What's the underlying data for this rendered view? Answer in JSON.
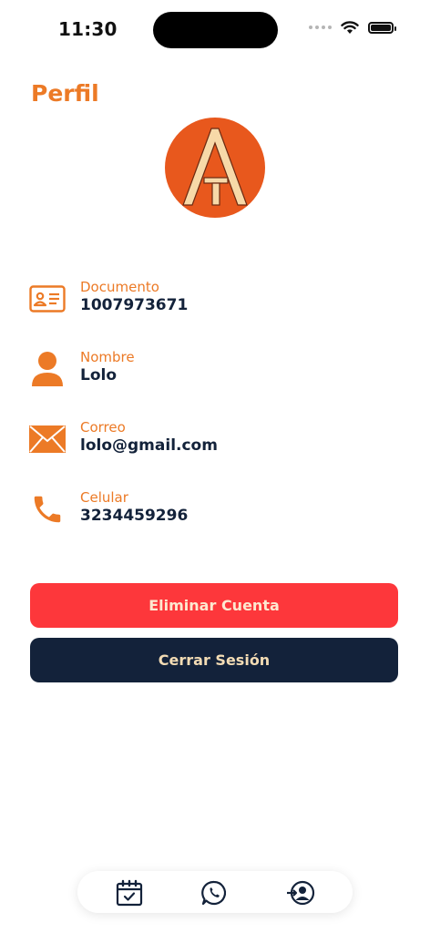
{
  "status_bar": {
    "time": "11:30"
  },
  "header": {
    "title": "Perfil"
  },
  "colors": {
    "accent": "#ec7a26",
    "navy": "#13223a",
    "danger": "#fd373b",
    "avatar_circle": "#e8581d",
    "avatar_letter": "#f7d9a8"
  },
  "profile": {
    "fields": [
      {
        "label": "Documento",
        "value": "1007973671",
        "icon": "id-card-icon"
      },
      {
        "label": "Nombre",
        "value": "Lolo",
        "icon": "user-icon"
      },
      {
        "label": "Correo",
        "value": "lolo@gmail.com",
        "icon": "envelope-icon"
      },
      {
        "label": "Celular",
        "value": "3234459296",
        "icon": "phone-icon"
      }
    ]
  },
  "actions": {
    "delete_label": "Eliminar Cuenta",
    "logout_label": "Cerrar Sesión"
  },
  "tabbar": {
    "items": [
      {
        "icon": "calendar-check-icon"
      },
      {
        "icon": "whatsapp-icon"
      },
      {
        "icon": "profile-login-icon"
      }
    ]
  }
}
